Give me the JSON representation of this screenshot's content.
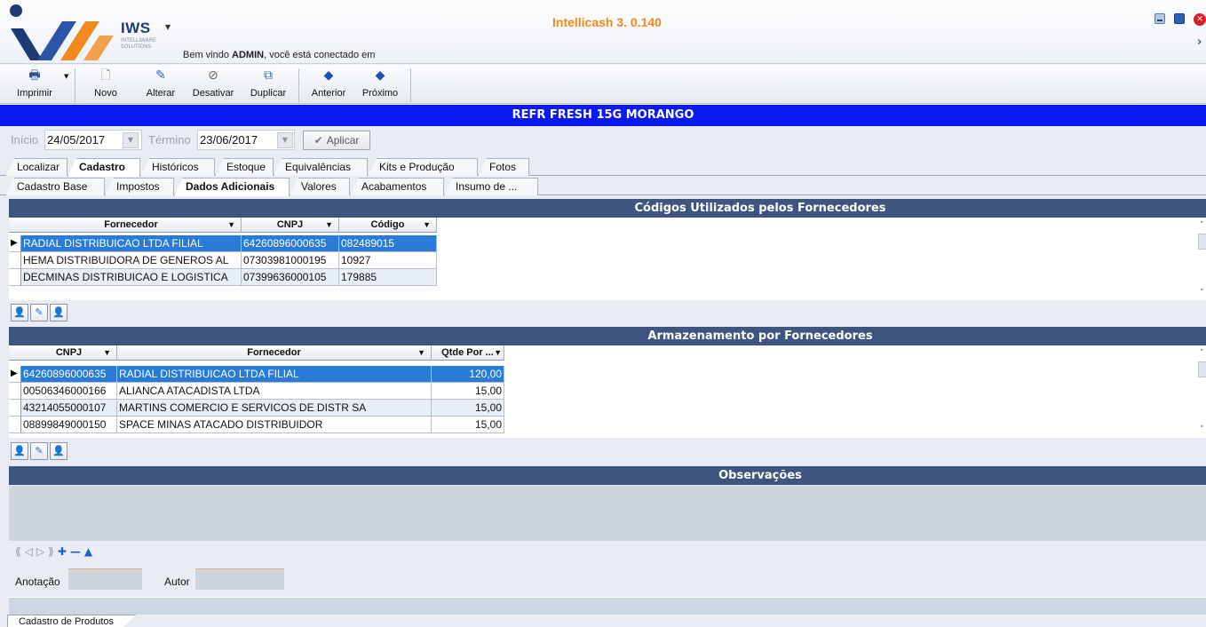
{
  "window": {
    "title": "Intellicash 3. 0.140",
    "welcome_prefix": "Bem vindo ",
    "welcome_user": "ADMIN",
    "welcome_suffix": ", você está conectado em"
  },
  "logo": {
    "brand": "IWS",
    "sub1": "INTELLIWARE",
    "sub2": "SOLUTIONS"
  },
  "toolbar": {
    "imprimir": "Imprimir",
    "novo": "Novo",
    "alterar": "Alterar",
    "desativar": "Desativar",
    "duplicar": "Duplicar",
    "anterior": "Anterior",
    "proximo": "Próximo"
  },
  "product": {
    "name": "REFR FRESH 15G MORANGO"
  },
  "filter": {
    "inicio_label": "Início",
    "inicio_value": "24/05/2017",
    "termino_label": "Término",
    "termino_value": "23/06/2017",
    "aplicar": "Aplicar"
  },
  "tabs_main": [
    "Localizar",
    "Cadastro",
    "Históricos",
    "Estoque",
    "Equivalências",
    "Kits e Produção",
    "Fotos"
  ],
  "tabs_sub": [
    "Cadastro Base",
    "Impostos",
    "Dados Adicionais",
    "Valores",
    "Acabamentos",
    "Insumo de ..."
  ],
  "codigos": {
    "title": "Códigos Utilizados pelos Fornecedores",
    "columns": [
      "Fornecedor",
      "CNPJ",
      "Código"
    ],
    "rows": [
      [
        "RADIAL DISTRIBUICAO LTDA FILIAL",
        "64260896000635",
        "082489015"
      ],
      [
        "HEMA DISTRIBUIDORA DE GENEROS AL",
        "07303981000195",
        "10927"
      ],
      [
        "DECMINAS DISTRIBUICAO E LOGISTICA",
        "07399636000105",
        "179885"
      ]
    ]
  },
  "armazenamento": {
    "title": "Armazenamento por Fornecedores",
    "columns": [
      "CNPJ",
      "Fornecedor",
      "Qtde Por ..."
    ],
    "rows": [
      [
        "64260896000635",
        "RADIAL DISTRIBUICAO LTDA FILIAL",
        "120,00"
      ],
      [
        "00506346000166",
        "ALIANCA ATACADISTA LTDA",
        "15,00"
      ],
      [
        "43214055000107",
        "MARTINS COMERCIO E SERVICOS DE DISTR SA",
        "15,00"
      ],
      [
        "08899849000150",
        "SPACE MINAS ATACADO DISTRIBUIDOR",
        "15,00"
      ]
    ]
  },
  "observacoes": {
    "title": "Observações",
    "anotacao_label": "Anotação",
    "autor_label": "Autor"
  },
  "bottom_tab": "Cadastro de Produtos",
  "colors": {
    "title_bar": "#0b19f2",
    "section_header": "#3f5580",
    "selection": "#2a7bd6",
    "app_title": "#ef8a1a"
  }
}
